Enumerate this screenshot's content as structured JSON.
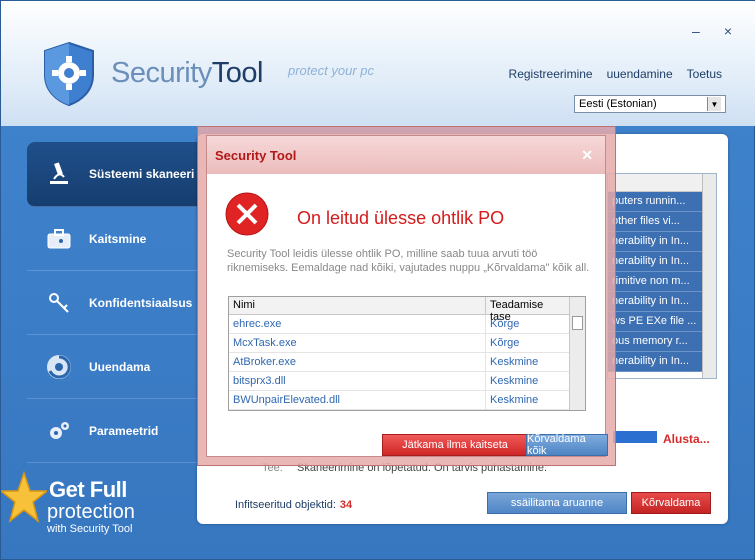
{
  "window": {
    "minimize": "–",
    "close": "×"
  },
  "logo": {
    "brand_light": "Security",
    "brand_bold": "Tool",
    "tagline": "protect your pc"
  },
  "topnav": [
    "Registreerimine",
    "uuendamine",
    "Toetus"
  ],
  "language": {
    "selected": "Eesti (Estonian)"
  },
  "sidebar": {
    "items": [
      {
        "label": "Süsteemi skaneeri",
        "icon": "microscope-icon",
        "active": true
      },
      {
        "label": "Kaitsmine",
        "icon": "briefcase-icon",
        "active": false
      },
      {
        "label": "Konfidentsiaalsus",
        "icon": "keys-icon",
        "active": false
      },
      {
        "label": "Uuendama",
        "icon": "swirl-icon",
        "active": false
      },
      {
        "label": "Parameetrid",
        "icon": "gears-icon",
        "active": false
      }
    ]
  },
  "threats_bg": [
    "puters runnin...",
    "other files vi...",
    "nerability in In...",
    "nerability in In...",
    "rimitive non m...",
    "nerability in In...",
    "ws PE EXe file ...",
    "ous memory r...",
    "nerability in In..."
  ],
  "scan": {
    "start_label": "Alusta...",
    "status_prefix": "Tee:",
    "status_text": "Skaneerimine on lõpetatud. On tarvis puhastamine."
  },
  "bottom": {
    "infected_label": "Infitseeritud objektid:",
    "infected_count": "34",
    "save_report": "ssäilitama aruanne",
    "remove": "Kõrvaldama"
  },
  "promo": {
    "line1": "Get Full",
    "line2": "protection",
    "line3": "with Security Tool"
  },
  "dialog": {
    "title": "Security Tool",
    "close": "✕",
    "heading": "On leitud ülesse ohtlik PO",
    "description": "Security Tool leidis ülesse ohtlik PO, milline saab tuua arvuti töö riknemiseks. Eemaldage nad kõiki, vajutades nuppu „Kõrvaldama\" kõik all.",
    "columns": [
      "Nimi",
      "Teadamise tase"
    ],
    "rows": [
      {
        "name": "ehrec.exe",
        "level": "Kõrge"
      },
      {
        "name": "McxTask.exe",
        "level": "Kõrge"
      },
      {
        "name": "AtBroker.exe",
        "level": "Keskmine"
      },
      {
        "name": "bitsprx3.dll",
        "level": "Keskmine"
      },
      {
        "name": "BWUnpairElevated.dll",
        "level": "Keskmine"
      }
    ],
    "btn_continue": "Jätkama ilma kaitseta",
    "btn_remove_all": "Kõrvaldama kõik"
  }
}
